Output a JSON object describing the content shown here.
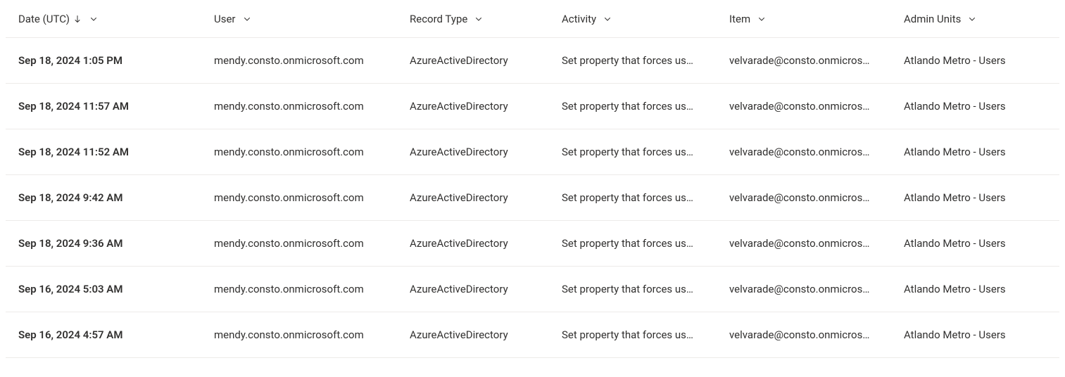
{
  "table": {
    "columns": {
      "date": {
        "label": "Date (UTC)",
        "sorted": "desc"
      },
      "user": {
        "label": "User"
      },
      "record": {
        "label": "Record Type"
      },
      "activity": {
        "label": "Activity"
      },
      "item": {
        "label": "Item"
      },
      "admin": {
        "label": "Admin Units"
      }
    },
    "rows": [
      {
        "date": "Sep 18, 2024 1:05 PM",
        "user": "mendy.consto.onmicrosoft.com",
        "record": "AzureActiveDirectory",
        "activity": "Set property that forces us…",
        "item": "velvarade@consto.onmicros…",
        "admin": "Atlando Metro - Users"
      },
      {
        "date": "Sep 18, 2024 11:57 AM",
        "user": "mendy.consto.onmicrosoft.com",
        "record": "AzureActiveDirectory",
        "activity": "Set property that forces us…",
        "item": "velvarade@consto.onmicros…",
        "admin": "Atlando Metro - Users"
      },
      {
        "date": "Sep 18, 2024 11:52 AM",
        "user": "mendy.consto.onmicrosoft.com",
        "record": "AzureActiveDirectory",
        "activity": "Set property that forces us…",
        "item": "velvarade@consto.onmicros…",
        "admin": "Atlando Metro - Users"
      },
      {
        "date": "Sep 18, 2024 9:42 AM",
        "user": "mendy.consto.onmicrosoft.com",
        "record": "AzureActiveDirectory",
        "activity": "Set property that forces us…",
        "item": "velvarade@consto.onmicros…",
        "admin": "Atlando Metro - Users"
      },
      {
        "date": "Sep 18, 2024 9:36 AM",
        "user": "mendy.consto.onmicrosoft.com",
        "record": "AzureActiveDirectory",
        "activity": "Set property that forces us…",
        "item": "velvarade@consto.onmicros…",
        "admin": "Atlando Metro - Users"
      },
      {
        "date": "Sep 16, 2024 5:03 AM",
        "user": "mendy.consto.onmicrosoft.com",
        "record": "AzureActiveDirectory",
        "activity": "Set property that forces us…",
        "item": "velvarade@consto.onmicros…",
        "admin": "Atlando Metro - Users"
      },
      {
        "date": "Sep 16, 2024 4:57 AM",
        "user": "mendy.consto.onmicrosoft.com",
        "record": "AzureActiveDirectory",
        "activity": "Set property that forces us…",
        "item": "velvarade@consto.onmicros…",
        "admin": "Atlando Metro - Users"
      }
    ]
  }
}
